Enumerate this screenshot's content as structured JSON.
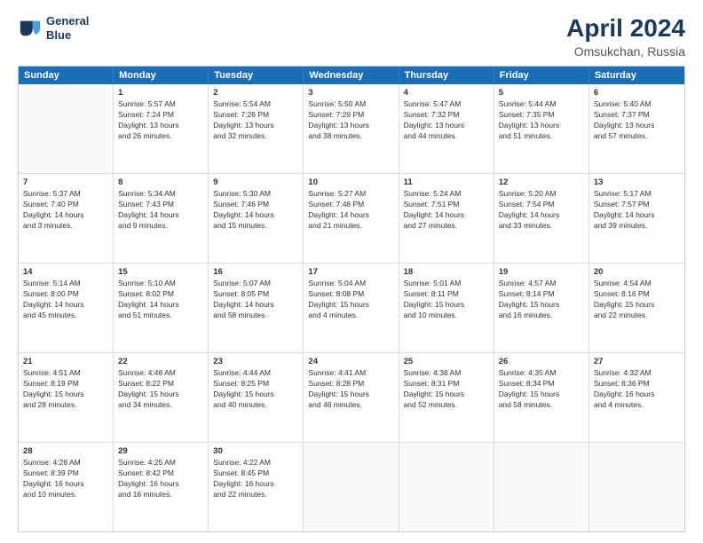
{
  "logo": {
    "line1": "General",
    "line2": "Blue"
  },
  "title": "April 2024",
  "subtitle": "Omsukchan, Russia",
  "header_days": [
    "Sunday",
    "Monday",
    "Tuesday",
    "Wednesday",
    "Thursday",
    "Friday",
    "Saturday"
  ],
  "weeks": [
    [
      {
        "day": "",
        "sunrise": "",
        "sunset": "",
        "daylight": ""
      },
      {
        "day": "1",
        "sunrise": "Sunrise: 5:57 AM",
        "sunset": "Sunset: 7:24 PM",
        "daylight": "Daylight: 13 hours",
        "daylight2": "and 26 minutes."
      },
      {
        "day": "2",
        "sunrise": "Sunrise: 5:54 AM",
        "sunset": "Sunset: 7:26 PM",
        "daylight": "Daylight: 13 hours",
        "daylight2": "and 32 minutes."
      },
      {
        "day": "3",
        "sunrise": "Sunrise: 5:50 AM",
        "sunset": "Sunset: 7:29 PM",
        "daylight": "Daylight: 13 hours",
        "daylight2": "and 38 minutes."
      },
      {
        "day": "4",
        "sunrise": "Sunrise: 5:47 AM",
        "sunset": "Sunset: 7:32 PM",
        "daylight": "Daylight: 13 hours",
        "daylight2": "and 44 minutes."
      },
      {
        "day": "5",
        "sunrise": "Sunrise: 5:44 AM",
        "sunset": "Sunset: 7:35 PM",
        "daylight": "Daylight: 13 hours",
        "daylight2": "and 51 minutes."
      },
      {
        "day": "6",
        "sunrise": "Sunrise: 5:40 AM",
        "sunset": "Sunset: 7:37 PM",
        "daylight": "Daylight: 13 hours",
        "daylight2": "and 57 minutes."
      }
    ],
    [
      {
        "day": "7",
        "sunrise": "Sunrise: 5:37 AM",
        "sunset": "Sunset: 7:40 PM",
        "daylight": "Daylight: 14 hours",
        "daylight2": "and 3 minutes."
      },
      {
        "day": "8",
        "sunrise": "Sunrise: 5:34 AM",
        "sunset": "Sunset: 7:43 PM",
        "daylight": "Daylight: 14 hours",
        "daylight2": "and 9 minutes."
      },
      {
        "day": "9",
        "sunrise": "Sunrise: 5:30 AM",
        "sunset": "Sunset: 7:46 PM",
        "daylight": "Daylight: 14 hours",
        "daylight2": "and 15 minutes."
      },
      {
        "day": "10",
        "sunrise": "Sunrise: 5:27 AM",
        "sunset": "Sunset: 7:48 PM",
        "daylight": "Daylight: 14 hours",
        "daylight2": "and 21 minutes."
      },
      {
        "day": "11",
        "sunrise": "Sunrise: 5:24 AM",
        "sunset": "Sunset: 7:51 PM",
        "daylight": "Daylight: 14 hours",
        "daylight2": "and 27 minutes."
      },
      {
        "day": "12",
        "sunrise": "Sunrise: 5:20 AM",
        "sunset": "Sunset: 7:54 PM",
        "daylight": "Daylight: 14 hours",
        "daylight2": "and 33 minutes."
      },
      {
        "day": "13",
        "sunrise": "Sunrise: 5:17 AM",
        "sunset": "Sunset: 7:57 PM",
        "daylight": "Daylight: 14 hours",
        "daylight2": "and 39 minutes."
      }
    ],
    [
      {
        "day": "14",
        "sunrise": "Sunrise: 5:14 AM",
        "sunset": "Sunset: 8:00 PM",
        "daylight": "Daylight: 14 hours",
        "daylight2": "and 45 minutes."
      },
      {
        "day": "15",
        "sunrise": "Sunrise: 5:10 AM",
        "sunset": "Sunset: 8:02 PM",
        "daylight": "Daylight: 14 hours",
        "daylight2": "and 51 minutes."
      },
      {
        "day": "16",
        "sunrise": "Sunrise: 5:07 AM",
        "sunset": "Sunset: 8:05 PM",
        "daylight": "Daylight: 14 hours",
        "daylight2": "and 58 minutes."
      },
      {
        "day": "17",
        "sunrise": "Sunrise: 5:04 AM",
        "sunset": "Sunset: 8:08 PM",
        "daylight": "Daylight: 15 hours",
        "daylight2": "and 4 minutes."
      },
      {
        "day": "18",
        "sunrise": "Sunrise: 5:01 AM",
        "sunset": "Sunset: 8:11 PM",
        "daylight": "Daylight: 15 hours",
        "daylight2": "and 10 minutes."
      },
      {
        "day": "19",
        "sunrise": "Sunrise: 4:57 AM",
        "sunset": "Sunset: 8:14 PM",
        "daylight": "Daylight: 15 hours",
        "daylight2": "and 16 minutes."
      },
      {
        "day": "20",
        "sunrise": "Sunrise: 4:54 AM",
        "sunset": "Sunset: 8:16 PM",
        "daylight": "Daylight: 15 hours",
        "daylight2": "and 22 minutes."
      }
    ],
    [
      {
        "day": "21",
        "sunrise": "Sunrise: 4:51 AM",
        "sunset": "Sunset: 8:19 PM",
        "daylight": "Daylight: 15 hours",
        "daylight2": "and 28 minutes."
      },
      {
        "day": "22",
        "sunrise": "Sunrise: 4:48 AM",
        "sunset": "Sunset: 8:22 PM",
        "daylight": "Daylight: 15 hours",
        "daylight2": "and 34 minutes."
      },
      {
        "day": "23",
        "sunrise": "Sunrise: 4:44 AM",
        "sunset": "Sunset: 8:25 PM",
        "daylight": "Daylight: 15 hours",
        "daylight2": "and 40 minutes."
      },
      {
        "day": "24",
        "sunrise": "Sunrise: 4:41 AM",
        "sunset": "Sunset: 8:28 PM",
        "daylight": "Daylight: 15 hours",
        "daylight2": "and 46 minutes."
      },
      {
        "day": "25",
        "sunrise": "Sunrise: 4:38 AM",
        "sunset": "Sunset: 8:31 PM",
        "daylight": "Daylight: 15 hours",
        "daylight2": "and 52 minutes."
      },
      {
        "day": "26",
        "sunrise": "Sunrise: 4:35 AM",
        "sunset": "Sunset: 8:34 PM",
        "daylight": "Daylight: 15 hours",
        "daylight2": "and 58 minutes."
      },
      {
        "day": "27",
        "sunrise": "Sunrise: 4:32 AM",
        "sunset": "Sunset: 8:36 PM",
        "daylight": "Daylight: 16 hours",
        "daylight2": "and 4 minutes."
      }
    ],
    [
      {
        "day": "28",
        "sunrise": "Sunrise: 4:28 AM",
        "sunset": "Sunset: 8:39 PM",
        "daylight": "Daylight: 16 hours",
        "daylight2": "and 10 minutes."
      },
      {
        "day": "29",
        "sunrise": "Sunrise: 4:25 AM",
        "sunset": "Sunset: 8:42 PM",
        "daylight": "Daylight: 16 hours",
        "daylight2": "and 16 minutes."
      },
      {
        "day": "30",
        "sunrise": "Sunrise: 4:22 AM",
        "sunset": "Sunset: 8:45 PM",
        "daylight": "Daylight: 16 hours",
        "daylight2": "and 22 minutes."
      },
      {
        "day": "",
        "sunrise": "",
        "sunset": "",
        "daylight": "",
        "daylight2": ""
      },
      {
        "day": "",
        "sunrise": "",
        "sunset": "",
        "daylight": "",
        "daylight2": ""
      },
      {
        "day": "",
        "sunrise": "",
        "sunset": "",
        "daylight": "",
        "daylight2": ""
      },
      {
        "day": "",
        "sunrise": "",
        "sunset": "",
        "daylight": "",
        "daylight2": ""
      }
    ]
  ]
}
